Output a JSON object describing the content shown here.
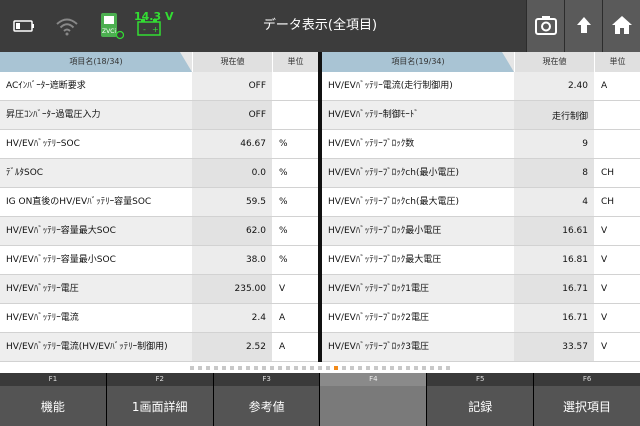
{
  "header": {
    "title": "データ表示(全項目)",
    "voltage": "14.3 V",
    "zvci_label": "ZVCi"
  },
  "left_table": {
    "col_name": "項目名(18/34)",
    "col_value": "現在値",
    "col_unit": "単位",
    "rows": [
      {
        "name": "ACｲﾝﾊﾞｰﾀｰ遮断要求",
        "value": "OFF",
        "unit": ""
      },
      {
        "name": "昇圧ｺﾝﾊﾞｰﾀｰ過電圧入力",
        "value": "OFF",
        "unit": ""
      },
      {
        "name": "HV/EVﾊﾞｯﾃﾘｰSOC",
        "value": "46.67",
        "unit": "%"
      },
      {
        "name": "ﾃﾞﾙﾀSOC",
        "value": "0.0",
        "unit": "%"
      },
      {
        "name": "IG ON直後のHV/EVﾊﾞｯﾃﾘｰ容量SOC",
        "value": "59.5",
        "unit": "%"
      },
      {
        "name": "HV/EVﾊﾞｯﾃﾘｰ容量最大SOC",
        "value": "62.0",
        "unit": "%"
      },
      {
        "name": "HV/EVﾊﾞｯﾃﾘｰ容量最小SOC",
        "value": "38.0",
        "unit": "%"
      },
      {
        "name": "HV/EVﾊﾞｯﾃﾘｰ電圧",
        "value": "235.00",
        "unit": "V"
      },
      {
        "name": "HV/EVﾊﾞｯﾃﾘｰ電流",
        "value": "2.4",
        "unit": "A"
      },
      {
        "name": "HV/EVﾊﾞｯﾃﾘｰ電流(HV/EVﾊﾞｯﾃﾘｰ制御用)",
        "value": "2.52",
        "unit": "A"
      }
    ]
  },
  "right_table": {
    "col_name": "項目名(19/34)",
    "col_value": "現在値",
    "col_unit": "単位",
    "rows": [
      {
        "name": "HV/EVﾊﾞｯﾃﾘｰ電流(走行制御用)",
        "value": "2.40",
        "unit": "A"
      },
      {
        "name": "HV/EVﾊﾞｯﾃﾘｰ制御ﾓｰﾄﾞ",
        "value": "走行制御",
        "unit": ""
      },
      {
        "name": "HV/EVﾊﾞｯﾃﾘｰﾌﾞﾛｯｸ数",
        "value": "9",
        "unit": ""
      },
      {
        "name": "HV/EVﾊﾞｯﾃﾘｰﾌﾞﾛｯｸch(最小電圧)",
        "value": "8",
        "unit": "CH"
      },
      {
        "name": "HV/EVﾊﾞｯﾃﾘｰﾌﾞﾛｯｸch(最大電圧)",
        "value": "4",
        "unit": "CH"
      },
      {
        "name": "HV/EVﾊﾞｯﾃﾘｰﾌﾞﾛｯｸ最小電圧",
        "value": "16.61",
        "unit": "V"
      },
      {
        "name": "HV/EVﾊﾞｯﾃﾘｰﾌﾞﾛｯｸ最大電圧",
        "value": "16.81",
        "unit": "V"
      },
      {
        "name": "HV/EVﾊﾞｯﾃﾘｰﾌﾞﾛｯｸ1電圧",
        "value": "16.71",
        "unit": "V"
      },
      {
        "name": "HV/EVﾊﾞｯﾃﾘｰﾌﾞﾛｯｸ2電圧",
        "value": "16.71",
        "unit": "V"
      },
      {
        "name": "HV/EVﾊﾞｯﾃﾘｰﾌﾞﾛｯｸ3電圧",
        "value": "33.57",
        "unit": "V"
      }
    ]
  },
  "pagination": {
    "total": 33,
    "current": 19
  },
  "fkeys": [
    {
      "key": "F1",
      "label": "機能"
    },
    {
      "key": "F2",
      "label": "1画面詳細"
    },
    {
      "key": "F3",
      "label": "参考値"
    },
    {
      "key": "F4",
      "label": ""
    },
    {
      "key": "F5",
      "label": "記録"
    },
    {
      "key": "F6",
      "label": "選択項目"
    }
  ],
  "icons": [
    "battery-icon",
    "wifi-icon",
    "zvci-device-icon",
    "car-battery-icon",
    "screenshot-icon",
    "upload-icon",
    "home-icon"
  ],
  "colors": {
    "accent_voltage": "#33dd33",
    "page_dot_active": "#f28a1a",
    "header_name_col": "#a9c4d4"
  }
}
